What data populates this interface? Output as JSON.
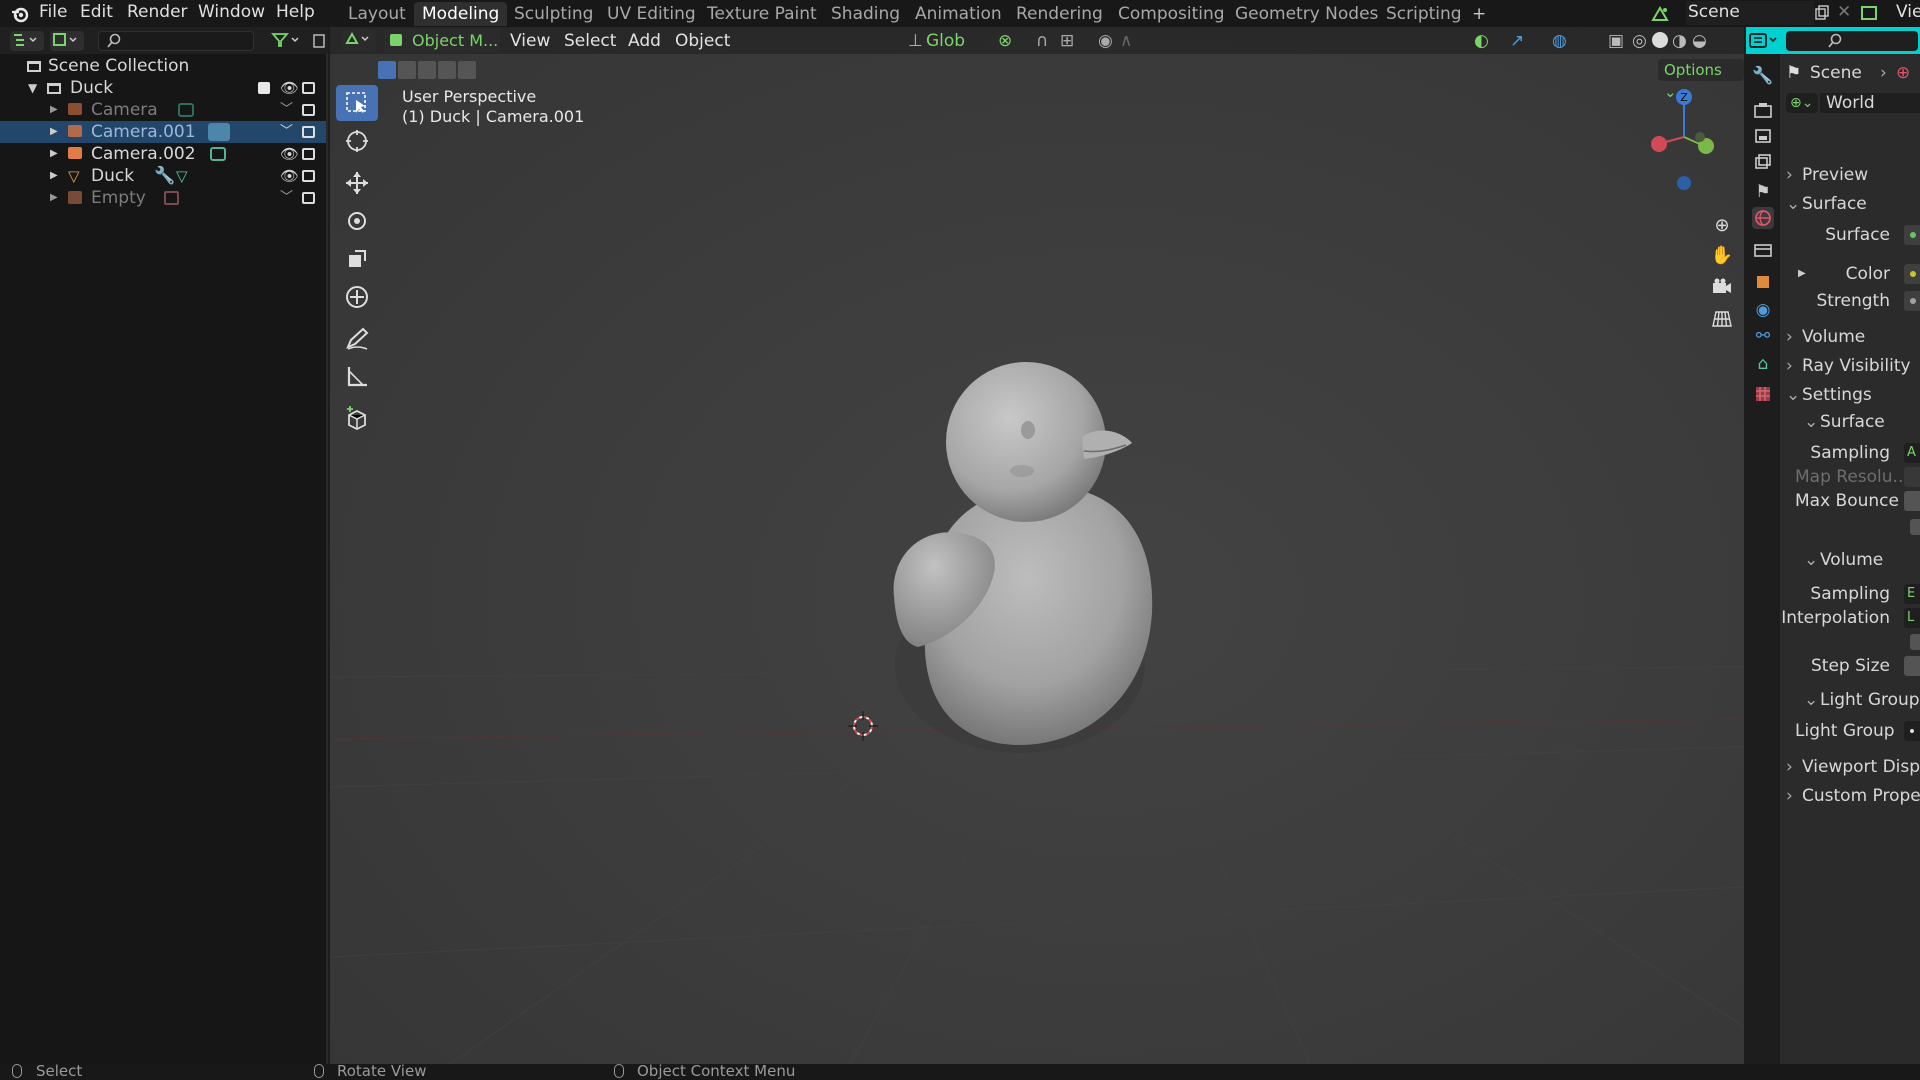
{
  "topbar": {
    "menus": [
      "File",
      "Edit",
      "Render",
      "Window",
      "Help"
    ],
    "workspaces": [
      "Layout",
      "Modeling",
      "Sculpting",
      "UV Editing",
      "Texture Paint",
      "Shading",
      "Animation",
      "Rendering",
      "Compositing",
      "Geometry Nodes",
      "Scripting"
    ],
    "active_workspace": "Modeling",
    "add_tab": "+",
    "scene_name": "Scene",
    "view_layer_partial": "Vie"
  },
  "outliner": {
    "root": "Scene Collection",
    "collection": "Duck",
    "items": [
      {
        "label": "Camera",
        "dimmed": true
      },
      {
        "label": "Camera.001",
        "dimmed": false,
        "selected": true
      },
      {
        "label": "Camera.002",
        "dimmed": false
      },
      {
        "label": "Duck",
        "dimmed": false
      },
      {
        "label": "Empty",
        "dimmed": true
      }
    ]
  },
  "viewport": {
    "mode": "Object M...",
    "menus": [
      "View",
      "Select",
      "Add",
      "Object"
    ],
    "transform_orientation": "Glob",
    "options": "Options",
    "overlay_line1": "User Perspective",
    "overlay_line2": "(1) Duck  | Camera.001",
    "gizmo_z": "Z"
  },
  "properties": {
    "breadcrumb": "Scene",
    "world_name": "World",
    "rows": [
      {
        "text": "Preview",
        "type": "section",
        "collapsed": true
      },
      {
        "text": "Surface",
        "type": "section",
        "collapsed": false
      },
      {
        "text": "Surface",
        "type": "field"
      },
      {
        "text": "Color",
        "type": "field"
      },
      {
        "text": "Strength",
        "type": "field"
      },
      {
        "text": "Volume",
        "type": "section",
        "collapsed": true
      },
      {
        "text": "Ray Visibility",
        "type": "section",
        "collapsed": true
      },
      {
        "text": "Settings",
        "type": "section",
        "collapsed": false
      },
      {
        "text": "Surface",
        "type": "subsection"
      },
      {
        "text": "Sampling",
        "type": "field"
      },
      {
        "text": "Map Resolu...",
        "type": "field-dim"
      },
      {
        "text": "Max Bounce",
        "type": "field-left"
      },
      {
        "text": "Volume",
        "type": "subsection"
      },
      {
        "text": "Sampling",
        "type": "field"
      },
      {
        "text": "Interpolation",
        "type": "field"
      },
      {
        "text": "Step Size",
        "type": "field"
      },
      {
        "text": "Light Group",
        "type": "subsection"
      },
      {
        "text": "Light Group",
        "type": "field-left"
      },
      {
        "text": "Viewport Displ",
        "type": "section",
        "collapsed": true
      },
      {
        "text": "Custom Prope",
        "type": "section",
        "collapsed": true
      }
    ]
  },
  "statusbar": {
    "items": [
      "Select",
      "Rotate View",
      "Object Context Menu"
    ]
  },
  "colors": {
    "accent_blue": "#4772b3",
    "selection_blue": "#23466b",
    "header_cyan": "#00d0d0",
    "mode_green": "#7bd36b"
  }
}
